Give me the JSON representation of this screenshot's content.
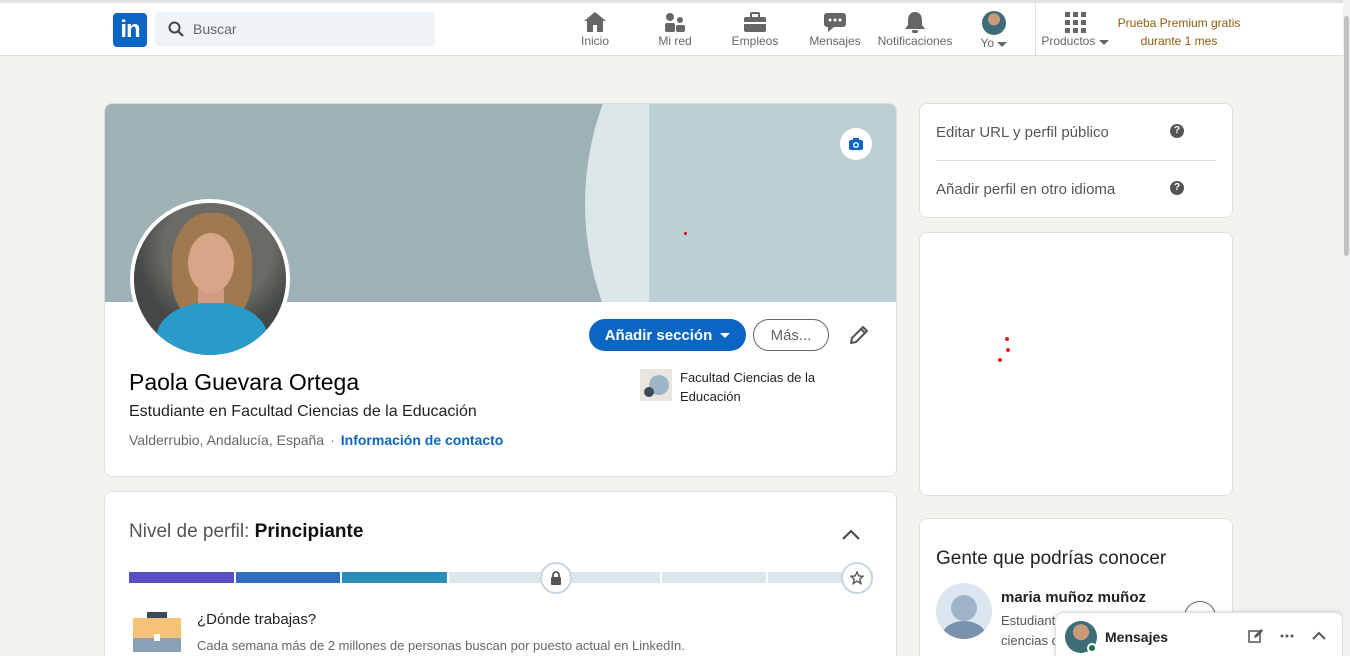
{
  "nav": {
    "logo_text": "in",
    "search_placeholder": "Buscar",
    "items": [
      {
        "label": "Inicio",
        "icon": "home-icon"
      },
      {
        "label": "Mi red",
        "icon": "network-icon"
      },
      {
        "label": "Empleos",
        "icon": "briefcase-icon"
      },
      {
        "label": "Mensajes",
        "icon": "messaging-icon"
      },
      {
        "label": "Notificaciones",
        "icon": "bell-icon"
      },
      {
        "label": "Yo",
        "icon": "avatar"
      },
      {
        "label": "Productos",
        "icon": "grid-icon"
      }
    ],
    "premium_line1": "Prueba Premium gratis",
    "premium_line2": "durante 1 mes"
  },
  "profile": {
    "name": "Paola Guevara Ortega",
    "headline": "Estudiante en Facultad Ciencias de la Educación",
    "location": "Valderrubio, Andalucía, España",
    "separator": "·",
    "contact_link": "Información de contacto",
    "add_section_label": "Añadir sección",
    "more_label": "Más...",
    "education_name": "Facultad Ciencias de la Educación"
  },
  "strength": {
    "title_prefix": "Nivel de perfil:",
    "level": "Principiante",
    "completed_segments": 3,
    "total_segments": 7,
    "question": "¿Dónde trabajas?",
    "description": "Cada semana más de 2 millones de personas buscan por puesto actual en LinkedIn."
  },
  "sidebar": {
    "edit_url": "Editar URL y perfil público",
    "add_language": "Añadir perfil en otro idioma",
    "people_title": "Gente que podrías conocer",
    "person_name": "maria muñoz muñoz",
    "person_subtitle": "Estudiante ciencias d"
  },
  "messaging": {
    "label": "Mensajes"
  },
  "colors": {
    "brand": "#0a66c2",
    "premium": "#915907",
    "bar_1": "#5b4fc4",
    "bar_2": "#2f6fbe",
    "bar_3": "#2a8fb8",
    "bar_empty": "#dce6ed"
  }
}
